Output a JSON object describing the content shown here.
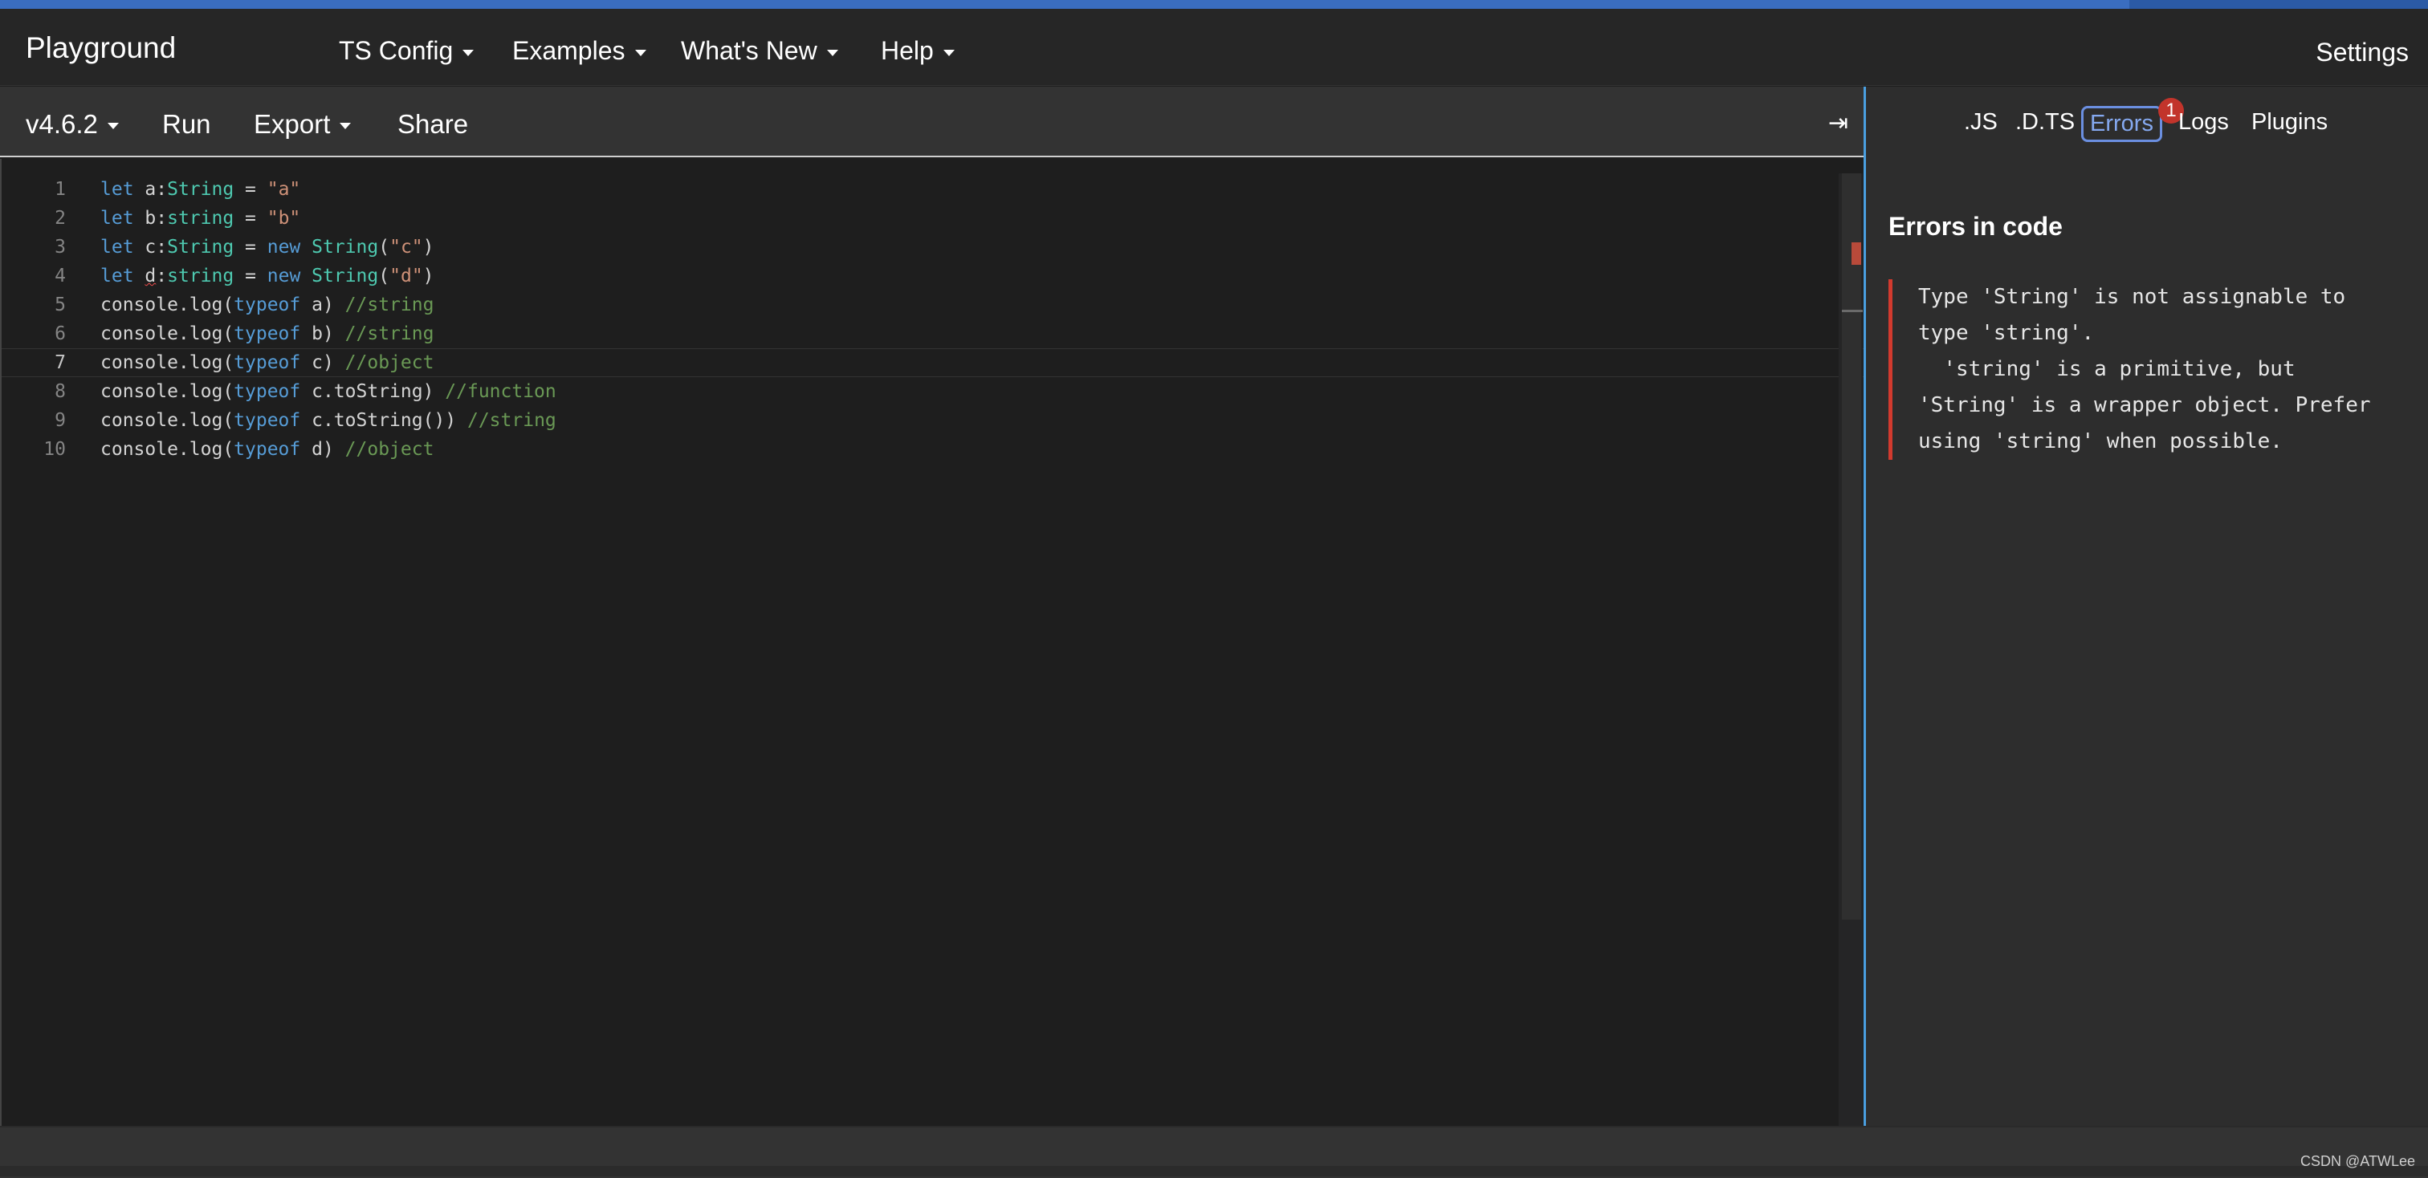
{
  "nav": {
    "brand": "Playground",
    "items": [
      "TS Config",
      "Examples",
      "What's New",
      "Help"
    ],
    "settings": "Settings"
  },
  "toolbar": {
    "version": "v4.6.2",
    "run": "Run",
    "export": "Export",
    "share": "Share",
    "collapse_glyph": "⇥"
  },
  "editor": {
    "current_line": 7,
    "line_numbers": [
      "1",
      "2",
      "3",
      "4",
      "5",
      "6",
      "7",
      "8",
      "9",
      "10"
    ],
    "lines": [
      "let a:String = \"a\"",
      "let b:string = \"b\"",
      "let c:String = new String(\"c\")",
      "let d:string = new String(\"d\")",
      "console.log(typeof a) //string",
      "console.log(typeof b) //string",
      "console.log(typeof c) //object",
      "console.log(typeof c.toString) //function",
      "console.log(typeof c.toString()) //string",
      "console.log(typeof d) //object"
    ]
  },
  "sidebar": {
    "tabs": [
      ".JS",
      ".D.TS",
      "Errors",
      "Logs",
      "Plugins"
    ],
    "active_tab": "Errors",
    "badge_count": "1",
    "errors_title": "Errors in code",
    "error_message": "Type 'String' is not assignable to\ntype 'string'.\n  'string' is a primitive, but\n'String' is a wrapper object. Prefer\nusing 'string' when possible."
  },
  "watermark": "CSDN @ATWLee",
  "colors": {
    "accent": "#3a6dbf",
    "keyword": "#569cd6",
    "type": "#4ec9b0",
    "string": "#ce9178",
    "comment": "#6a9955",
    "error": "#d23a2e"
  }
}
